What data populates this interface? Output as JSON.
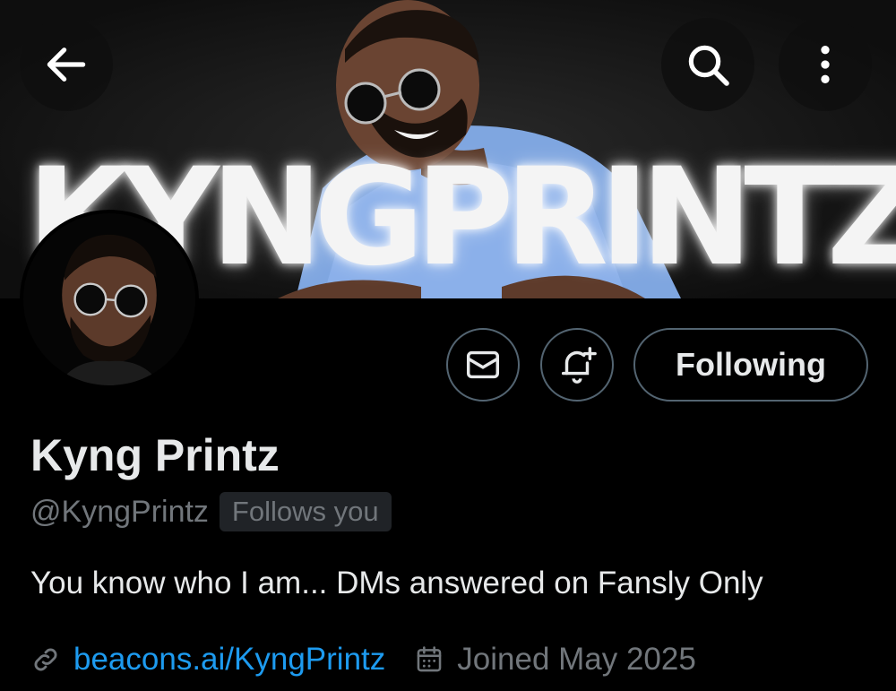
{
  "banner": {
    "wordmark": "KYNGPRINTZ"
  },
  "header": {
    "back_icon": "arrow-left-icon",
    "search_icon": "search-icon",
    "more_icon": "more-vertical-icon"
  },
  "actions": {
    "message_icon": "envelope-icon",
    "notify_icon": "bell-plus-icon",
    "following_label": "Following"
  },
  "profile": {
    "display_name": "Kyng Printz",
    "handle": "@KyngPrintz",
    "follows_you": "Follows you",
    "bio": "You know who I am... DMs answered on Fansly Only",
    "link": "beacons.ai/KyngPrintz",
    "joined": "Joined May 2025"
  },
  "colors": {
    "background": "#000000",
    "text_primary": "#e7e9ea",
    "text_secondary": "#71767b",
    "link": "#1d9bf0",
    "button_border": "#536471"
  }
}
